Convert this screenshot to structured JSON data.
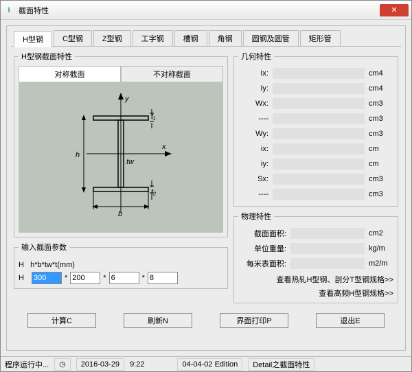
{
  "window": {
    "title": "截面特性"
  },
  "tabs": [
    "H型钢",
    "C型钢",
    "Z型钢",
    "工字钢",
    "槽钢",
    "角钢",
    "圆钢及圆管",
    "矩形管"
  ],
  "section_group": {
    "title": "H型钢截面特性",
    "subtabs": [
      "对称截面",
      "不对称截面"
    ]
  },
  "diagram_labels": {
    "y": "y",
    "x": "x",
    "h": "h",
    "b": "b",
    "t1": "t1",
    "t2": "t2",
    "tw": "tw"
  },
  "params": {
    "header": "输入截面参数",
    "formula_lbl": "H",
    "formula": "h*b*tw*t(mm)",
    "row_lbl": "H",
    "h": "300",
    "b": "200",
    "tw": "6",
    "t": "8",
    "sep": "*"
  },
  "geometric": {
    "title": "几何特性",
    "rows": [
      {
        "lbl": "Ix:",
        "unit": "cm4"
      },
      {
        "lbl": "Iy:",
        "unit": "cm4"
      },
      {
        "lbl": "Wx:",
        "unit": "cm3"
      },
      {
        "lbl": "----",
        "unit": "cm3"
      },
      {
        "lbl": "Wy:",
        "unit": "cm3"
      },
      {
        "lbl": "ix:",
        "unit": "cm"
      },
      {
        "lbl": "iy:",
        "unit": "cm"
      },
      {
        "lbl": "Sx:",
        "unit": "cm3"
      },
      {
        "lbl": "----",
        "unit": "cm3"
      }
    ]
  },
  "physical": {
    "title": "物理特性",
    "rows": [
      {
        "lbl": "截面面积:",
        "unit": "cm2"
      },
      {
        "lbl": "单位重量:",
        "unit": "kg/m"
      },
      {
        "lbl": "每米表面积:",
        "unit": "m2/m"
      }
    ],
    "link1": "查看热轧H型钢、剖分T型钢规格>>",
    "link2": "查看高频H型钢规格>>"
  },
  "buttons": {
    "calc": "计算C",
    "refresh": "刷新N",
    "print": "界面打印P",
    "exit": "退出E"
  },
  "status": {
    "running": "程序运行中...",
    "date": "2016-03-29",
    "time": "9:22",
    "edition": "04-04-02 Edition",
    "detail": "Detail之截面特性"
  }
}
